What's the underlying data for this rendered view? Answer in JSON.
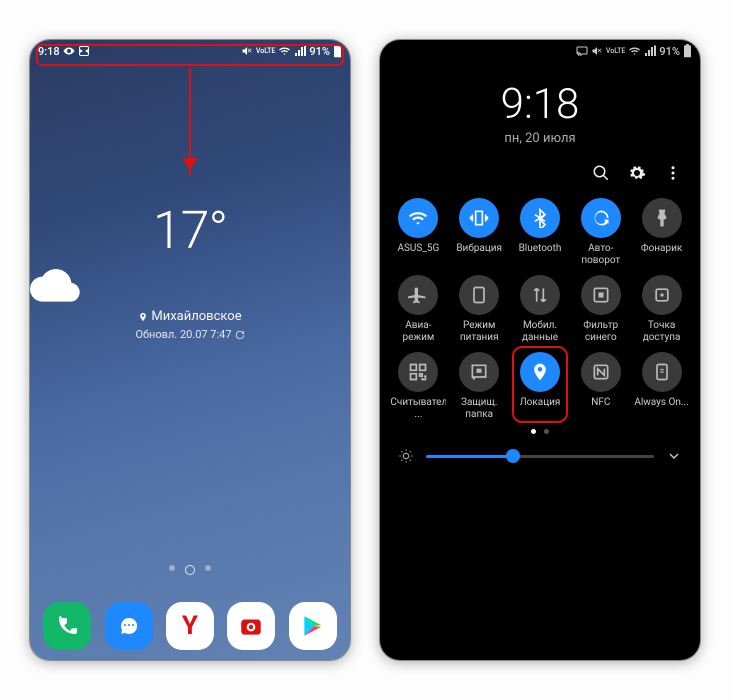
{
  "home": {
    "statusbar": {
      "time": "9:18",
      "battery": "91%"
    },
    "weather": {
      "temp": "17°",
      "location": "Михайловское",
      "updated": "Обновл. 20.07 7:47"
    },
    "dock": {
      "phone": "phone",
      "messages": "messages",
      "yandex_label": "Y",
      "camera": "camera",
      "play": "play"
    }
  },
  "qs": {
    "statusbar": {
      "battery": "91%"
    },
    "time": "9:18",
    "date": "пн, 20 июля",
    "tiles": [
      {
        "key": "wifi",
        "label": "ASUS_5G",
        "on": true,
        "icon": "wifi"
      },
      {
        "key": "vibration",
        "label": "Вибрация",
        "on": true,
        "icon": "vibration"
      },
      {
        "key": "bluetooth",
        "label": "Bluetooth",
        "on": true,
        "icon": "bluetooth"
      },
      {
        "key": "rotate",
        "label": "Авто-поворот",
        "on": true,
        "icon": "rotate"
      },
      {
        "key": "torch",
        "label": "Фонарик",
        "on": false,
        "icon": "torch"
      },
      {
        "key": "airplane",
        "label": "Авиа-режим",
        "on": false,
        "icon": "airplane"
      },
      {
        "key": "power",
        "label": "Режим питания",
        "on": false,
        "icon": "power"
      },
      {
        "key": "data",
        "label": "Мобил. данные",
        "on": false,
        "icon": "data"
      },
      {
        "key": "bluelight",
        "label": "Фильтр синего",
        "on": false,
        "icon": "bluelight"
      },
      {
        "key": "hotspot",
        "label": "Точка доступа",
        "on": false,
        "icon": "hotspot"
      },
      {
        "key": "qr",
        "label": "Считыватель ...",
        "on": false,
        "icon": "qr"
      },
      {
        "key": "secure",
        "label": "Защищ. папка",
        "on": false,
        "icon": "secure"
      },
      {
        "key": "location",
        "label": "Локация",
        "on": true,
        "icon": "location",
        "highlight": true
      },
      {
        "key": "nfc",
        "label": "NFC",
        "on": false,
        "icon": "nfc"
      },
      {
        "key": "aod",
        "label": "Always On...",
        "on": false,
        "icon": "aod"
      }
    ],
    "brightness_pct": 38
  }
}
